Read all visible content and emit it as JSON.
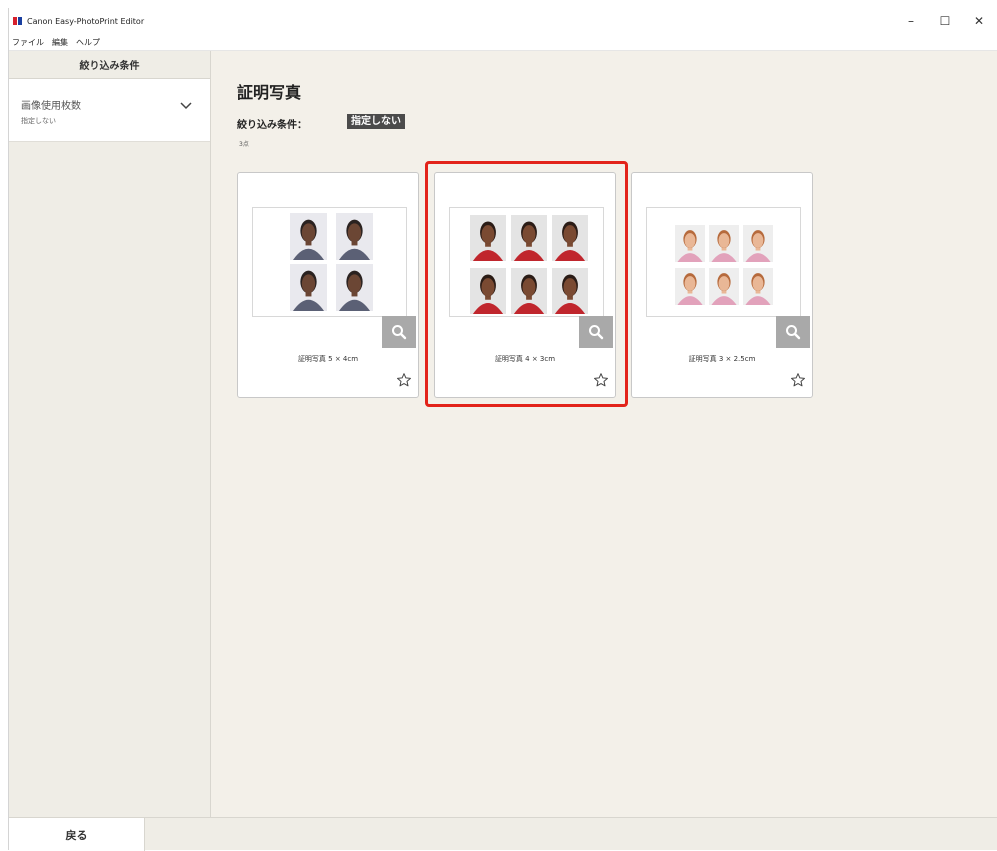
{
  "window": {
    "title": "Canon Easy-PhotoPrint Editor",
    "controls": {
      "minimize": "–",
      "maximize": "☐",
      "close": "✕"
    },
    "brand_colors": [
      "#d6202c",
      "#1a3fa0"
    ]
  },
  "menu": [
    "ファイル",
    "編集",
    "ヘルプ"
  ],
  "sidebar": {
    "header": "絞り込み条件",
    "filter": {
      "title": "画像使用枚数",
      "value": "指定しない",
      "icon": "chevron-down-icon"
    }
  },
  "main": {
    "title": "証明写真",
    "condition_label": "絞り込み条件：",
    "condition_badge": "指定しない",
    "count": "3点",
    "cards": [
      {
        "label": "証明写真 5 × 4cm",
        "shirt_color": "#5b6075",
        "selected": false
      },
      {
        "label": "証明写真 4 × 3cm",
        "shirt_color": "#c0262d",
        "selected": true
      },
      {
        "label": "証明写真 3 × 2.5cm",
        "shirt_color": "#e2a2bb",
        "selected": false
      }
    ],
    "highlight_color": "#e2231a"
  },
  "footer": {
    "back": "戻る"
  }
}
